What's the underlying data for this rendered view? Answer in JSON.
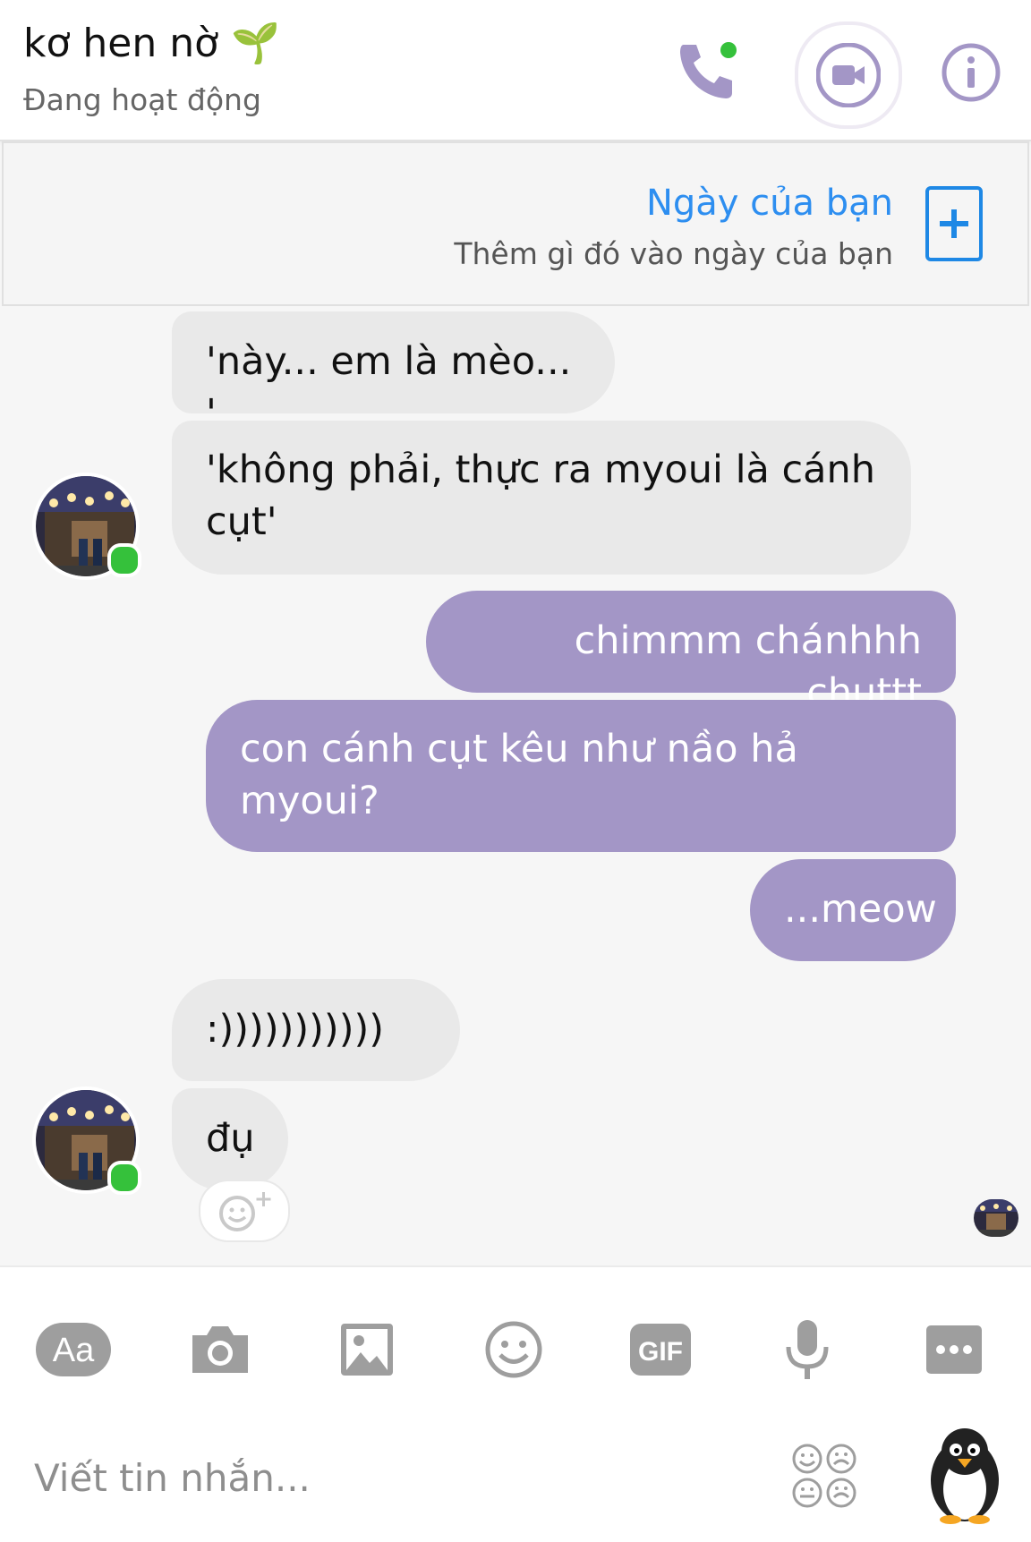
{
  "header": {
    "contact_name": "kơ hen nờ",
    "contact_name_emoji": "🌱",
    "status": "Đang hoạt động",
    "accent_color": "#a396c6",
    "online_color": "#35c13b",
    "buttons": {
      "call": "phone-icon",
      "video": "video-camera-icon",
      "info": "info-icon"
    }
  },
  "day_panel": {
    "title": "Ngày của bạn",
    "subtitle": "Thêm gì đó vào ngày của bạn",
    "add_icon": "plus-icon"
  },
  "messages": [
    {
      "from": "them",
      "text": "'này... em là mèo... '"
    },
    {
      "from": "them",
      "text": "'không phải, thực ra myoui là cánh cụt'"
    },
    {
      "from": "me",
      "text": "chimmm chánhhh chụttt"
    },
    {
      "from": "me",
      "text": "con cánh cụt kêu như nầo hả myoui?"
    },
    {
      "from": "me",
      "text": "...meow"
    },
    {
      "from": "them",
      "text": ":)))))))))))"
    },
    {
      "from": "them",
      "text": "đụ"
    }
  ],
  "composer": {
    "placeholder": "Viết tin nhắn...",
    "text_mode_label": "Aa",
    "gif_label": "GIF",
    "tools": [
      "text-format-icon",
      "camera-icon",
      "gallery-icon",
      "emoji-icon",
      "gif-icon",
      "microphone-icon",
      "more-icon"
    ],
    "emoji_grid": "emoji-grid-icon",
    "quick_sticker": "penguin-sticker-icon"
  }
}
